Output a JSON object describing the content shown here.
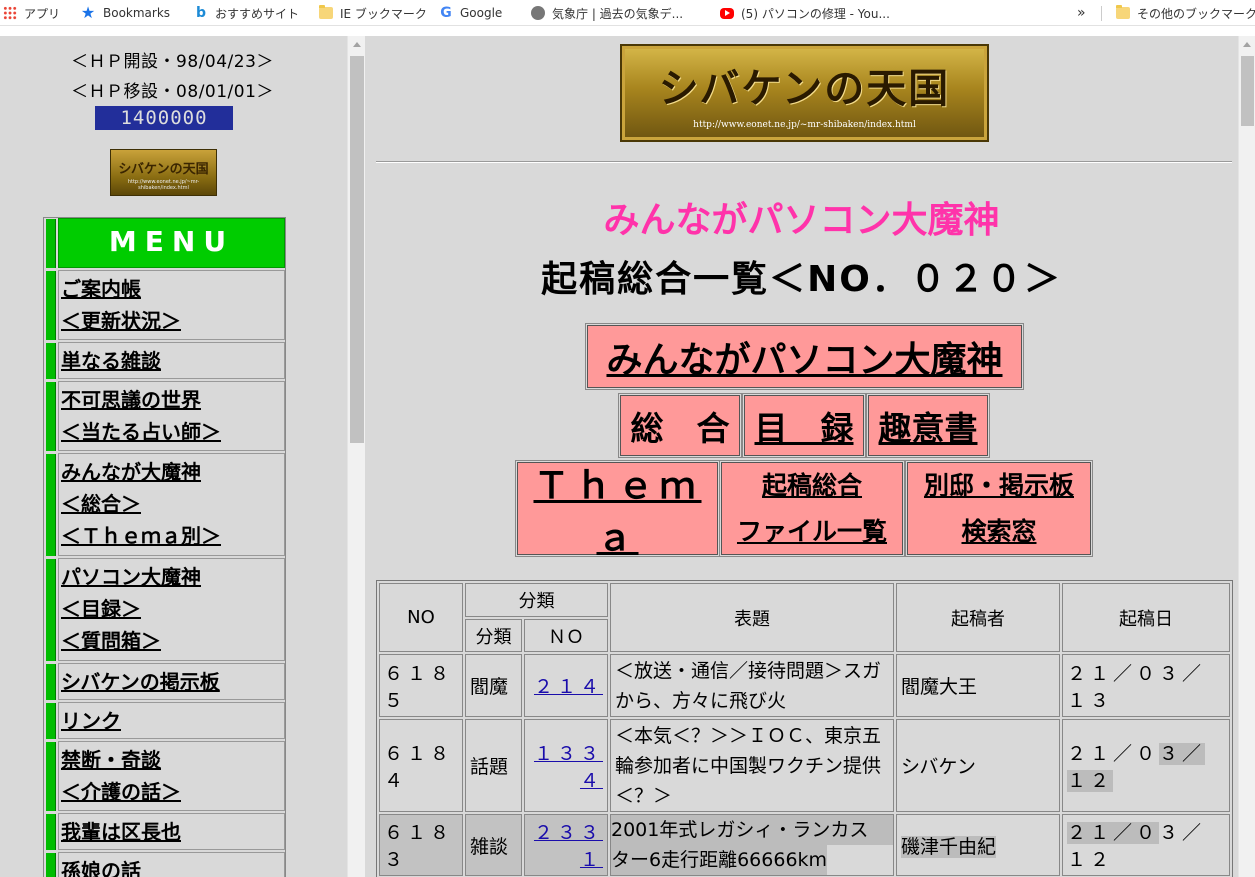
{
  "bookmarks_bar": {
    "items": [
      {
        "label": "アプリ",
        "icon": "apps-grid-icon"
      },
      {
        "label": "Bookmarks",
        "icon": "star-icon"
      },
      {
        "label": "おすすめサイト",
        "icon": "bing-icon"
      },
      {
        "label": "IE ブックマーク",
        "icon": "folder-icon"
      },
      {
        "label": "Google",
        "icon": "google-icon"
      },
      {
        "label": "気象庁 | 過去の気象デ...",
        "icon": "globe-icon"
      },
      {
        "label": "(5) パソコンの修理 - You...",
        "icon": "youtube-icon"
      }
    ],
    "overflow_label": "»",
    "other_bookmarks": "その他のブックマーク"
  },
  "left": {
    "hp_opened": "＜ＨＰ開設・98/04/23＞",
    "hp_moved": "＜ＨＰ移設・08/01/01＞",
    "counter": "1400000",
    "small_logo": "シバケンの天国",
    "menu": {
      "header": "MENU",
      "items": [
        [
          "ご案内帳",
          "＜更新状況＞"
        ],
        [
          "単なる雑談"
        ],
        [
          "不可思議の世界",
          "＜当たる占い師＞"
        ],
        [
          "みんなが大魔神",
          "＜総合＞",
          "＜Ｔｈｅｍａ別＞"
        ],
        [
          "パソコン大魔神",
          "＜目録＞",
          "＜質問箱＞"
        ],
        [
          "シバケンの掲示板"
        ],
        [
          "リンク"
        ],
        [
          "禁断・奇談",
          "＜介護の話＞"
        ],
        [
          "我輩は区長也"
        ],
        [
          "孫娘の話"
        ]
      ]
    }
  },
  "right": {
    "logo_title": "シバケンの天国",
    "logo_url": "http://www.eonet.ne.jp/~mr-shibaken/index.html",
    "heading_pink": "みんながパソコン大魔神",
    "heading_black": "起稿総合一覧＜NO．０２０＞",
    "nav": {
      "banner": "みんながパソコン大魔神",
      "sougou": "総　合",
      "mokuroku": "目　録",
      "shuisho": "趣意書",
      "thema": "Ｔｈｅｍａ",
      "kikou_1": "起稿総合",
      "kikou_2": "ファイル一覧",
      "bettei_1": "別邸・掲示板",
      "bettei_2": "検索窓"
    },
    "table": {
      "headers": {
        "no": "NO",
        "category": "分類",
        "cat_sub": "分類",
        "cat_no": "ＮＯ",
        "title": "表題",
        "author": "起稿者",
        "date": "起稿日"
      },
      "rows": [
        {
          "no": "６１８５",
          "cat": "閻魔",
          "cat_no": "２１４",
          "title": "＜放送・通信／接待問題＞スガから、方々に飛び火",
          "author": "閻魔大王",
          "date": "２１／０３／１３"
        },
        {
          "no": "６１８４",
          "cat": "話題",
          "cat_no": "１３３４",
          "title": "＜本気＜？＞＞ＩＯＣ、東京五輪参加者に中国製ワクチン提供＜？＞",
          "author": "シバケン",
          "date_a": "２１／０",
          "date_b": "３／１２"
        },
        {
          "no": "６１８３",
          "cat": "雑談",
          "cat_no": "２３３１",
          "title_1": "2001年式レガシィ・ランカス",
          "title_2": "ター6走行距離66666km",
          "author": "磯津千由紀",
          "date_a": "２１／０",
          "date_b": "３／１２"
        }
      ]
    }
  }
}
